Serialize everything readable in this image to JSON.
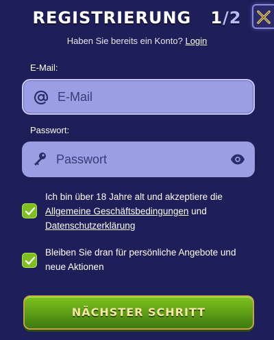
{
  "header": {
    "title": "Registrierung",
    "step_current": "1",
    "step_separator": "/",
    "step_total": "2",
    "subtitle_text": "Haben Sie bereits ein Konto?",
    "login_link": "Login"
  },
  "email": {
    "label": "E-Mail:",
    "placeholder": "E-Mail",
    "value": "",
    "icon": "at-icon"
  },
  "password": {
    "label": "Passwort:",
    "placeholder": "Passwort",
    "value": "",
    "icon": "key-icon",
    "toggle_icon": "eye-icon"
  },
  "terms": {
    "checked": true,
    "text_prefix": "Ich bin über 18 Jahre alt und akzeptiere die",
    "agb_link": "Allgemeine Geschäftsbedingungen",
    "and_text": "und",
    "privacy_link": "Datenschutzerklärung"
  },
  "offers": {
    "checked": true,
    "text": "Bleiben Sie dran für persönliche Angebote und neue Aktionen"
  },
  "submit": {
    "label": "Nächster Schritt"
  },
  "colors": {
    "background": "#1e1e58",
    "input_bg": "#9c9ee3",
    "checkbox": "#7fbf1f",
    "button_green": "#5f9e17",
    "button_text": "#f6e7a2"
  }
}
